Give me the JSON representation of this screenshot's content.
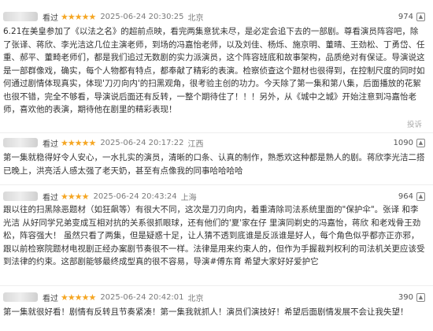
{
  "reviews": [
    {
      "status": "看过",
      "stars": "★★★★★",
      "date": "2025-06-24 20:30:25",
      "location": "北京",
      "useful": "974",
      "text": "6.21在美皇参加了《以法之名》的超前点映，看完两集意犹未尽，是必定会追下去的一部剧。尊看演员阵容吧，除了张译、蒋欣、李光洁这几位主演老师，到场的冯嘉怡老师，以及刘佳、杨烁、施京明、董晴、王劲松、丁勇岱、任重、郝平、董畸老师们，都是我们追过无数剧的实力派演员，这个阵容班底和故事架构，品质绝对有保证。导演说这是一部群像戏，确实，每个人物都有特点，都奉献了精彩的表演。检察侦查这个题材也很得到，在控制尺度的同时如何通过剧情体现真实，体现'刀刃向内'的扫黑观角，很考验主创的功力。今天除了第一集和第八集，后面播放的花絮也很不错，完全不够看，导演说后面还有反转，一整个期待住了！！！另外，从《城中之城》开始注意到冯嘉怡老师，喜欢他的表演，期待他在剧里的精彩表现！",
      "fold": "投诉"
    },
    {
      "status": "看过",
      "stars": "★★★★★",
      "date": "2025-06-24 20:17:22",
      "location": "江西",
      "useful": "1090",
      "text": "第一集就稳得好令人安心，一水扎实的演员，清晰的口条、认真的制作，熟悉欢这种都是熟人的剧。蒋欣李光洁二搭已晚上，洪亮活人感太强了老天奶，甚至有点像我的同事哈哈哈哈"
    },
    {
      "status": "看过",
      "stars": "★★★★",
      "date": "2025-06-24 20:43:24",
      "location": "上海",
      "useful": "964",
      "text": "跟以往的扫黑除恶题材（如狂飙等）有很大不同，这次是刀刃向内，着重清除司法系统里面的\"保护伞\"。张译 和李光洁 从好同学兄弟变成互相对抗的关系很抓眼球，还有他们的'夏'家在仔 里演同剃史的冯嘉怡，蒋欣 和老戏骨王劲松，阵容强大！ 虽然只看了两集，但是疑惑十足，让人猜不透到底谁是反派谁是好人，每个角色似乎都亦正亦邪，跟以前检察院题材电视剧正经办案剧节奏很不一样。法律是用来约束人的，但作为手握裁判权利的司法机关更应该受到法律的约束。这部剧能够最终成型真的很不容易，导演#傅东育 希望大家好好爱护它"
    },
    {
      "status": "看过",
      "stars": "★★★★★",
      "date": "2025-06-24 20:42:01",
      "location": "北京",
      "useful": "390",
      "text": "第一集就很好看！剧情有反转且节奏紧凑！第一集我就抓人！演员们演技好！希望后面剧情发展不会让我失望！"
    }
  ],
  "icons": {
    "useful": "thumbs-up-icon"
  }
}
